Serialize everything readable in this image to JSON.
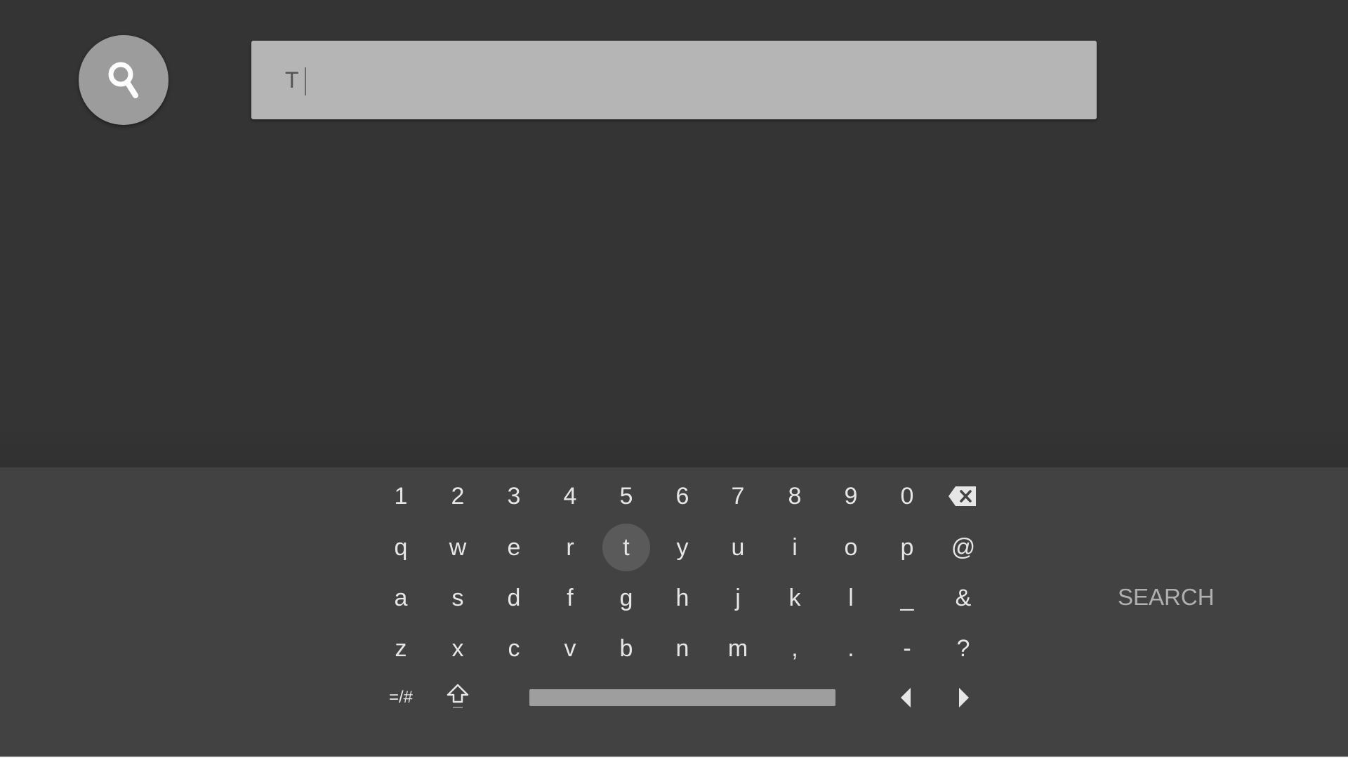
{
  "search": {
    "query": "T"
  },
  "keyboard": {
    "rows": [
      [
        "1",
        "2",
        "3",
        "4",
        "5",
        "6",
        "7",
        "8",
        "9",
        "0"
      ],
      [
        "q",
        "w",
        "e",
        "r",
        "t",
        "y",
        "u",
        "i",
        "o",
        "p",
        "@"
      ],
      [
        "a",
        "s",
        "d",
        "f",
        "g",
        "h",
        "j",
        "k",
        "l",
        "_",
        "&"
      ],
      [
        "z",
        "x",
        "c",
        "v",
        "b",
        "n",
        "m",
        ",",
        ".",
        "-",
        "?"
      ]
    ],
    "symbols_label": "=/#",
    "focused_key": "t",
    "search_label": "SEARCH"
  },
  "icons": {
    "search_orb": "search-icon",
    "backspace": "backspace-icon",
    "shift": "shift-icon",
    "left": "arrow-left-icon",
    "right": "arrow-right-icon"
  },
  "colors": {
    "background": "#333333",
    "keyboard_bg": "#424242",
    "search_box": "#b5b5b5",
    "orb": "#9c9c9c",
    "focus": "#5a5a5a"
  }
}
